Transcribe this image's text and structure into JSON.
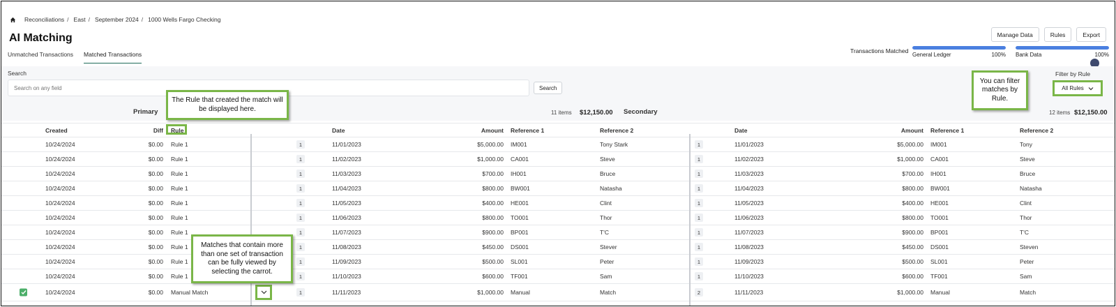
{
  "breadcrumb": {
    "items": [
      "Reconciliations",
      "East",
      "September 2024",
      "1000 Wells Fargo Checking"
    ],
    "separator": "/"
  },
  "page_title": "AI Matching",
  "tabs": [
    {
      "label": "Unmatched Transactions",
      "active": false
    },
    {
      "label": "Matched Transactions",
      "active": true
    }
  ],
  "top_buttons": {
    "manage_data": "Manage Data",
    "rules": "Rules",
    "export": "Export"
  },
  "transactions_matched": {
    "label": "Transactions Matched",
    "general_ledger": {
      "label": "General Ledger",
      "value": "100%",
      "fraction": 1.0
    },
    "bank_data": {
      "label": "Bank Data",
      "value": "100%",
      "fraction": 1.0
    }
  },
  "search": {
    "label": "Search",
    "placeholder": "Search on any field",
    "button": "Search"
  },
  "filter": {
    "label": "Filter by Rule",
    "selected": "All Rules"
  },
  "primary": {
    "label": "Primary",
    "items": "11 items",
    "total": "$12,150.00"
  },
  "secondary": {
    "label": "Secondary",
    "items": "12 items",
    "total": "$12,150.00"
  },
  "headers": {
    "created": "Created",
    "diff": "Diff",
    "rule": "Rule",
    "p_date": "Date",
    "p_amount": "Amount",
    "p_ref1": "Reference 1",
    "p_ref2": "Reference 2",
    "s_date": "Date",
    "s_amount": "Amount",
    "s_ref1": "Reference 1",
    "s_ref2": "Reference 2"
  },
  "rows": [
    {
      "created": "10/24/2024",
      "diff": "$0.00",
      "rule": "Rule 1",
      "p_count": "1",
      "p_date": "11/01/2023",
      "p_amount": "$5,000.00",
      "p_ref1": "IM001",
      "p_ref2": "Tony Stark",
      "s_count": "1",
      "s_date": "11/01/2023",
      "s_amount": "$5,000.00",
      "s_ref1": "IM001",
      "s_ref2": "Tony"
    },
    {
      "created": "10/24/2024",
      "diff": "$0.00",
      "rule": "Rule 1",
      "p_count": "1",
      "p_date": "11/02/2023",
      "p_amount": "$1,000.00",
      "p_ref1": "CA001",
      "p_ref2": "Steve",
      "s_count": "1",
      "s_date": "11/02/2023",
      "s_amount": "$1,000.00",
      "s_ref1": "CA001",
      "s_ref2": "Steve"
    },
    {
      "created": "10/24/2024",
      "diff": "$0.00",
      "rule": "Rule 1",
      "p_count": "1",
      "p_date": "11/03/2023",
      "p_amount": "$700.00",
      "p_ref1": "IH001",
      "p_ref2": "Bruce",
      "s_count": "1",
      "s_date": "11/03/2023",
      "s_amount": "$700.00",
      "s_ref1": "IH001",
      "s_ref2": "Bruce"
    },
    {
      "created": "10/24/2024",
      "diff": "$0.00",
      "rule": "Rule 1",
      "p_count": "1",
      "p_date": "11/04/2023",
      "p_amount": "$800.00",
      "p_ref1": "BW001",
      "p_ref2": "Natasha",
      "s_count": "1",
      "s_date": "11/04/2023",
      "s_amount": "$800.00",
      "s_ref1": "BW001",
      "s_ref2": "Natasha"
    },
    {
      "created": "10/24/2024",
      "diff": "$0.00",
      "rule": "Rule 1",
      "p_count": "1",
      "p_date": "11/05/2023",
      "p_amount": "$400.00",
      "p_ref1": "HE001",
      "p_ref2": "Clint",
      "s_count": "1",
      "s_date": "11/05/2023",
      "s_amount": "$400.00",
      "s_ref1": "HE001",
      "s_ref2": "Clint"
    },
    {
      "created": "10/24/2024",
      "diff": "$0.00",
      "rule": "Rule 1",
      "p_count": "1",
      "p_date": "11/06/2023",
      "p_amount": "$800.00",
      "p_ref1": "TO001",
      "p_ref2": "Thor",
      "s_count": "1",
      "s_date": "11/06/2023",
      "s_amount": "$800.00",
      "s_ref1": "TO001",
      "s_ref2": "Thor"
    },
    {
      "created": "10/24/2024",
      "diff": "$0.00",
      "rule": "Rule 1",
      "p_count": "1",
      "p_date": "11/07/2023",
      "p_amount": "$900.00",
      "p_ref1": "BP001",
      "p_ref2": "T'C",
      "s_count": "1",
      "s_date": "11/07/2023",
      "s_amount": "$900.00",
      "s_ref1": "BP001",
      "s_ref2": "T'C"
    },
    {
      "created": "10/24/2024",
      "diff": "$0.00",
      "rule": "Rule 1",
      "p_count": "1",
      "p_date": "11/08/2023",
      "p_amount": "$450.00",
      "p_ref1": "DS001",
      "p_ref2": "Stever",
      "s_count": "1",
      "s_date": "11/08/2023",
      "s_amount": "$450.00",
      "s_ref1": "DS001",
      "s_ref2": "Steven"
    },
    {
      "created": "10/24/2024",
      "diff": "$0.00",
      "rule": "Rule 1",
      "p_count": "1",
      "p_date": "11/09/2023",
      "p_amount": "$500.00",
      "p_ref1": "SL001",
      "p_ref2": "Peter",
      "s_count": "1",
      "s_date": "11/09/2023",
      "s_amount": "$500.00",
      "s_ref1": "SL001",
      "s_ref2": "Peter"
    },
    {
      "created": "10/24/2024",
      "diff": "$0.00",
      "rule": "Rule 1",
      "p_count": "1",
      "p_date": "11/10/2023",
      "p_amount": "$600.00",
      "p_ref1": "TF001",
      "p_ref2": "Sam",
      "s_count": "1",
      "s_date": "11/10/2023",
      "s_amount": "$600.00",
      "s_ref1": "TF001",
      "s_ref2": "Sam"
    },
    {
      "created": "10/24/2024",
      "diff": "$0.00",
      "rule": "Manual Match",
      "checked": true,
      "expandable": true,
      "p_count": "1",
      "p_date": "11/11/2023",
      "p_amount": "$1,000.00",
      "p_ref1": "Manual",
      "p_ref2": "Match",
      "s_count": "2",
      "s_date": "11/11/2023",
      "s_amount": "$1,000.00",
      "s_ref1": "Manual",
      "s_ref2": "Match"
    }
  ],
  "callouts": {
    "rule": "The Rule that created the match will be displayed here.",
    "filter": "You can filter matches by Rule.",
    "carrot": "Matches that contain more than one set of transaction can be fully viewed by selecting the carrot."
  },
  "colors": {
    "accent_green": "#7ab648",
    "progress_blue": "#4a7fe0",
    "tab_underline": "#1f6b5a",
    "checkbox_green": "#4caf6a"
  },
  "icons": [
    "home-icon",
    "chevron-down-icon",
    "checkmark-icon"
  ]
}
